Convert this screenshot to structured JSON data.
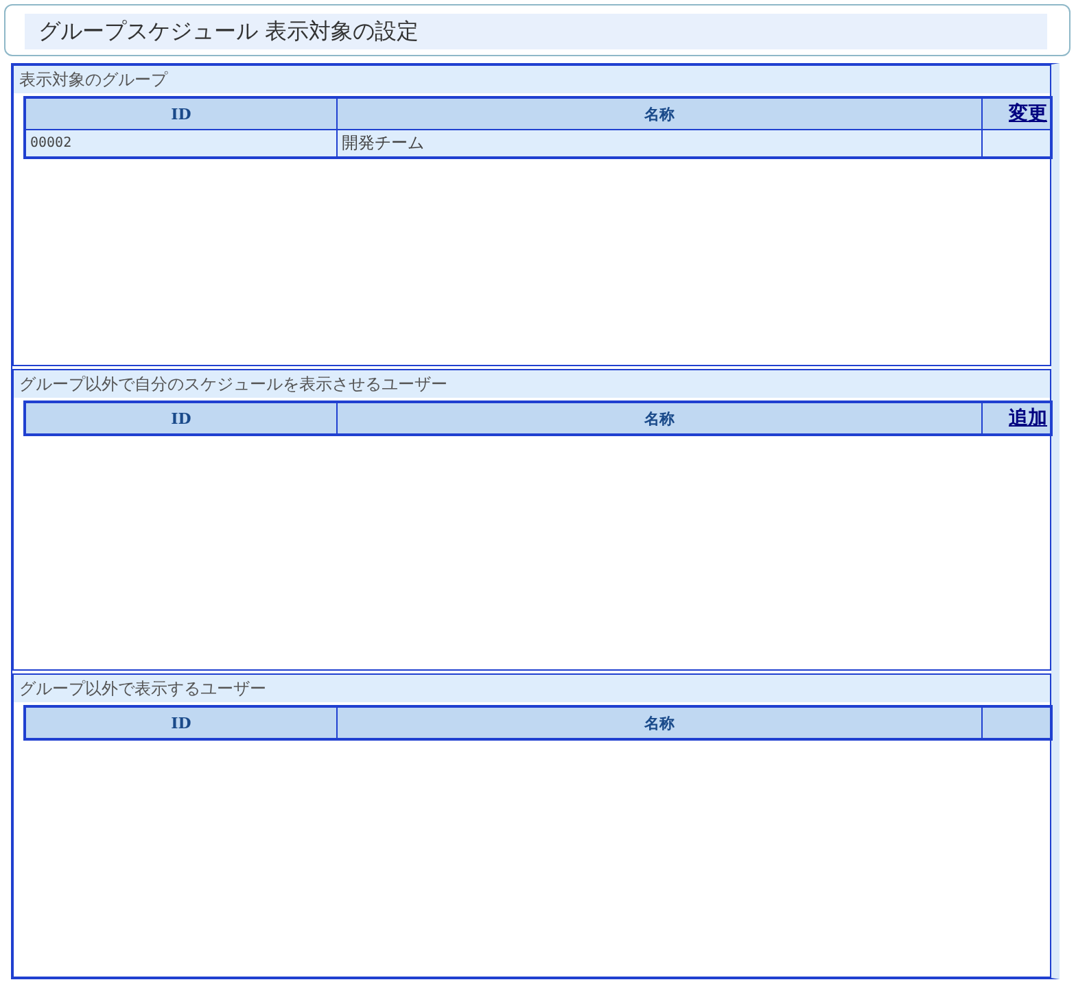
{
  "title": "グループスケジュール 表示対象の設定",
  "sections": [
    {
      "heading": "表示対象のグループ",
      "columns": [
        "ID",
        "名称"
      ],
      "action_link": "変更",
      "rows": [
        {
          "id": "00002",
          "name": "開発チーム"
        }
      ]
    },
    {
      "heading": "グループ以外で自分のスケジュールを表示させるユーザー",
      "columns": [
        "ID",
        "名称"
      ],
      "action_link": "追加"
    },
    {
      "heading": "グループ以外で表示するユーザー",
      "columns": [
        "ID",
        "名称"
      ]
    }
  ]
}
